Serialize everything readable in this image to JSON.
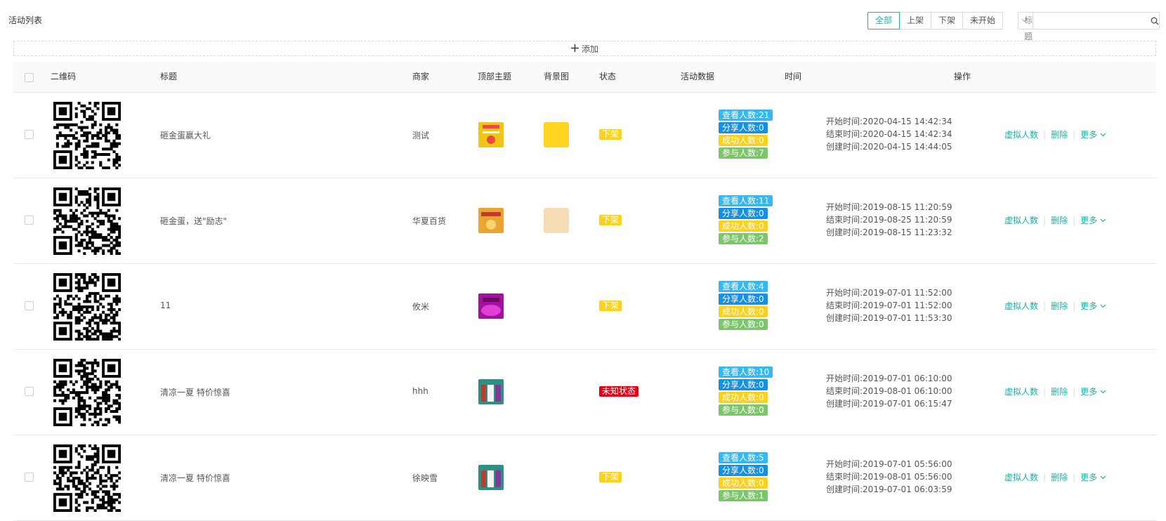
{
  "page_title": "活动列表",
  "filters": [
    {
      "label": "全部",
      "active": true
    },
    {
      "label": "上架",
      "active": false
    },
    {
      "label": "下架",
      "active": false
    },
    {
      "label": "未开始",
      "active": false
    }
  ],
  "search": {
    "type_label": "标题",
    "value": "",
    "placeholder": ""
  },
  "add_label": "添加",
  "columns": {
    "qr": "二维码",
    "title": "标题",
    "merchant": "商家",
    "top_theme": "顶部主题",
    "background": "背景图",
    "status": "状态",
    "stats": "活动数据",
    "time": "时间",
    "ops": "操作"
  },
  "stat_labels": {
    "view": "查看人数",
    "share": "分享人数",
    "success": "成功人数",
    "join": "参与人数"
  },
  "time_labels": {
    "start": "开始时间",
    "end": "结束时间",
    "created": "创建时间"
  },
  "op_labels": {
    "virtual": "虚拟人数",
    "delete": "删除",
    "more": "更多"
  },
  "colors": {
    "accent": "#17b3a3",
    "status_off": "#fad11e",
    "status_unknown": "#e60012",
    "stat_view": "#37b7ef",
    "stat_share": "#1690e0",
    "stat_success": "#fad11e",
    "stat_join": "#7cc56a"
  },
  "rows": [
    {
      "title": "砸金蛋赢大礼",
      "merchant": "测试",
      "status": "下架",
      "status_type": "off",
      "stats": {
        "view": "查看人数:21",
        "share": "分享人数:0",
        "success": "成功人数:0",
        "join": "参与人数:7"
      },
      "times": {
        "start": "开始时间:2020-04-15 14:42:34",
        "end": "结束时间:2020-04-15 14:42:34",
        "created": "创建时间:2020-04-15 14:44:05"
      },
      "theme_color": "#f0c419",
      "bg_color": "#fed322"
    },
    {
      "title": "砸金蛋，送\"励志\"",
      "merchant": "华夏百货",
      "status": "下架",
      "status_type": "off",
      "stats": {
        "view": "查看人数:11",
        "share": "分享人数:0",
        "success": "成功人数:0",
        "join": "参与人数:2"
      },
      "times": {
        "start": "开始时间:2019-08-15 11:20:59",
        "end": "结束时间:2019-08-25 11:20:59",
        "created": "创建时间:2019-08-15 11:23:32"
      },
      "theme_color": "#e8a534",
      "bg_color": "#f7ddb5"
    },
    {
      "title": "11",
      "merchant": "攸米",
      "status": "下架",
      "status_type": "off",
      "stats": {
        "view": "查看人数:4",
        "share": "分享人数:0",
        "success": "成功人数:0",
        "join": "参与人数:0"
      },
      "times": {
        "start": "开始时间:2019-07-01 11:52:00",
        "end": "结束时间:2019-07-01 11:52:00",
        "created": "创建时间:2019-07-01 11:53:30"
      },
      "theme_color": "#a2129c",
      "bg_color": ""
    },
    {
      "title": "清凉一夏 特价惊喜",
      "merchant": "hhh",
      "status": "未知状态",
      "status_type": "unknown",
      "stats": {
        "view": "查看人数:10",
        "share": "分享人数:0",
        "success": "成功人数:0",
        "join": "参与人数:0"
      },
      "times": {
        "start": "开始时间:2019-07-01 06:10:00",
        "end": "结束时间:2019-08-01 06:10:00",
        "created": "创建时间:2019-07-01 06:15:47"
      },
      "theme_color": "#2e8f84",
      "bg_color": ""
    },
    {
      "title": "清凉一夏 特价惊喜",
      "merchant": "徐映雪",
      "status": "下架",
      "status_type": "off",
      "stats": {
        "view": "查看人数:5",
        "share": "分享人数:0",
        "success": "成功人数:0",
        "join": "参与人数:1"
      },
      "times": {
        "start": "开始时间:2019-07-01 05:56:00",
        "end": "结束时间:2019-08-01 05:56:00",
        "created": "创建时间:2019-07-01 06:03:59"
      },
      "theme_color": "#2e8f84",
      "bg_color": ""
    }
  ]
}
